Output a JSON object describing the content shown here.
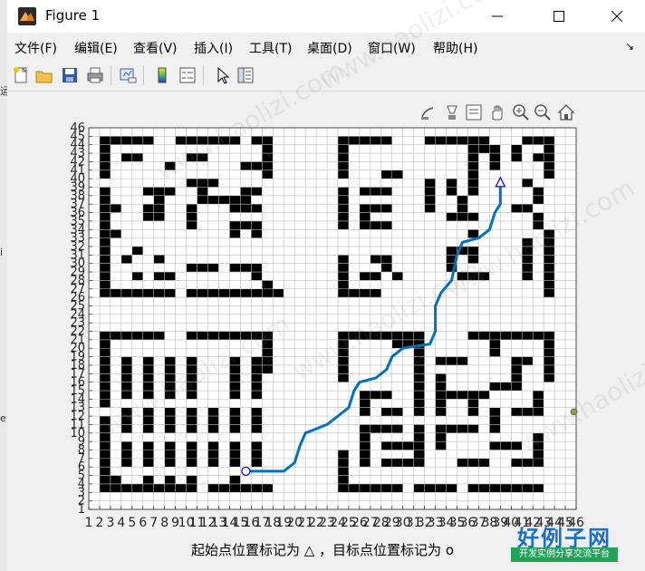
{
  "window": {
    "title": "Figure 1"
  },
  "menu": {
    "items": [
      "文件(F)",
      "编辑(E)",
      "查看(V)",
      "插入(I)",
      "工具(T)",
      "桌面(D)",
      "窗口(W)",
      "帮助(H)"
    ]
  },
  "toolbar": {
    "buttons": [
      "new-figure",
      "open",
      "save",
      "print",
      "link-plot",
      "insert-colorbar",
      "insert-legend",
      "edit-plot",
      "property-inspector"
    ]
  },
  "axes_toolbar": {
    "buttons": [
      "brush",
      "data-cursor",
      "data-tips",
      "pan",
      "zoom-in",
      "zoom-out",
      "home"
    ]
  },
  "caption": "起始点位置标记为 △ ，目标点位置标记为 o",
  "watermark": {
    "title": "好例子网",
    "subtitle": "开发实例分享交流平台",
    "diagonal_text": "www.haolizi.com"
  },
  "chart_data": {
    "type": "heatmap",
    "description_of_values": "occupancy grid 45x45: 1 = obstacle (black), 0 = free (white)",
    "x_ticks": [
      "1",
      "2",
      "3",
      "4",
      "5",
      "6",
      "7",
      "8",
      "9",
      "10",
      "11",
      "12",
      "13",
      "14",
      "15",
      "16",
      "17",
      "18",
      "19",
      "20",
      "21",
      "22",
      "23",
      "24",
      "25",
      "26",
      "27",
      "28",
      "29",
      "30",
      "31",
      "32",
      "33",
      "34",
      "35",
      "36",
      "37",
      "38",
      "39",
      "40",
      "41",
      "42",
      "43",
      "44",
      "45",
      "46"
    ],
    "y_ticks": [
      "1",
      "2",
      "3",
      "4",
      "5",
      "6",
      "7",
      "8",
      "9",
      "10",
      "11",
      "12",
      "13",
      "14",
      "15",
      "16",
      "17",
      "18",
      "19",
      "20",
      "21",
      "22",
      "23",
      "24",
      "25",
      "26",
      "27",
      "28",
      "29",
      "30",
      "31",
      "32",
      "33",
      "34",
      "35",
      "36",
      "37",
      "38",
      "39",
      "40",
      "41",
      "42",
      "43",
      "44",
      "45",
      "46"
    ],
    "xlim": [
      1,
      46
    ],
    "ylim": [
      1,
      46
    ],
    "grid": true,
    "start_marker": {
      "symbol": "triangle",
      "x": 39,
      "y": 39.5
    },
    "goal_marker": {
      "symbol": "circle",
      "x": 15.5,
      "y": 5.5
    },
    "path": [
      [
        15.5,
        5.5
      ],
      [
        19,
        5.5
      ],
      [
        20,
        6.5
      ],
      [
        20.5,
        8.5
      ],
      [
        21,
        10
      ],
      [
        22,
        10.5
      ],
      [
        23,
        11
      ],
      [
        24,
        12
      ],
      [
        25,
        13
      ],
      [
        25.5,
        15
      ],
      [
        26,
        16
      ],
      [
        27.5,
        16.5
      ],
      [
        28.5,
        17.5
      ],
      [
        29,
        19
      ],
      [
        30,
        20
      ],
      [
        32.5,
        20.5
      ],
      [
        33,
        22
      ],
      [
        33,
        25
      ],
      [
        33.5,
        26.5
      ],
      [
        34.5,
        28
      ],
      [
        35,
        31
      ],
      [
        35.5,
        32.5
      ],
      [
        37,
        33
      ],
      [
        38,
        34
      ],
      [
        38.5,
        36
      ],
      [
        39,
        37
      ],
      [
        39,
        39.5
      ]
    ],
    "obstacles": [
      [
        2,
        44,
        5,
        1
      ],
      [
        9,
        44,
        6,
        1
      ],
      [
        16,
        44,
        2,
        1
      ],
      [
        2,
        40,
        1,
        5
      ],
      [
        4,
        42,
        2,
        1
      ],
      [
        8,
        41,
        1,
        1
      ],
      [
        10,
        42,
        2,
        1
      ],
      [
        15,
        41,
        2,
        1
      ],
      [
        17,
        40,
        1,
        5
      ],
      [
        6,
        38,
        3,
        1
      ],
      [
        7,
        37,
        1,
        2
      ],
      [
        10,
        39,
        3,
        1
      ],
      [
        11,
        38,
        1,
        1
      ],
      [
        11,
        37,
        3,
        1
      ],
      [
        15,
        38,
        2,
        1
      ],
      [
        14,
        37,
        2,
        1
      ],
      [
        14,
        36,
        3,
        1
      ],
      [
        2,
        32,
        1,
        7
      ],
      [
        3,
        36,
        1,
        1
      ],
      [
        3,
        33,
        1,
        1
      ],
      [
        6,
        35,
        2,
        2
      ],
      [
        10,
        34,
        1,
        3
      ],
      [
        14,
        34,
        2,
        1
      ],
      [
        14,
        33,
        1,
        2
      ],
      [
        16,
        33,
        1,
        2
      ],
      [
        2,
        27,
        1,
        5
      ],
      [
        2,
        26,
        7,
        1
      ],
      [
        5,
        31,
        1,
        1
      ],
      [
        4,
        30,
        1,
        1
      ],
      [
        7,
        30,
        1,
        1
      ],
      [
        5,
        28,
        1,
        1
      ],
      [
        7,
        28,
        2,
        1
      ],
      [
        10,
        29,
        3,
        1
      ],
      [
        14,
        29,
        3,
        1
      ],
      [
        16,
        28,
        1,
        1
      ],
      [
        10,
        26,
        9,
        1
      ],
      [
        17,
        26,
        1,
        2
      ],
      [
        24,
        40,
        1,
        5
      ],
      [
        24,
        44,
        5,
        1
      ],
      [
        28,
        40,
        2,
        1
      ],
      [
        26,
        38,
        3,
        1
      ],
      [
        26,
        36,
        3,
        1
      ],
      [
        26,
        35,
        1,
        1
      ],
      [
        24,
        34,
        1,
        5
      ],
      [
        26,
        34,
        3,
        1
      ],
      [
        32,
        44,
        6,
        1
      ],
      [
        32,
        36,
        1,
        4
      ],
      [
        34,
        38,
        1,
        2
      ],
      [
        36,
        38,
        1,
        2
      ],
      [
        35,
        36,
        1,
        2
      ],
      [
        34,
        35,
        3,
        1
      ],
      [
        36,
        43,
        3,
        1
      ],
      [
        36,
        40,
        1,
        3
      ],
      [
        38,
        41,
        1,
        2
      ],
      [
        41,
        44,
        2,
        1
      ],
      [
        40,
        42,
        1,
        2
      ],
      [
        42,
        42,
        2,
        1
      ],
      [
        41,
        39,
        1,
        1
      ],
      [
        42,
        37,
        1,
        2
      ],
      [
        40,
        36,
        2,
        1
      ],
      [
        42,
        34,
        1,
        2
      ],
      [
        43,
        40,
        1,
        5
      ],
      [
        36,
        33,
        1,
        1
      ],
      [
        34,
        31,
        2,
        1
      ],
      [
        34,
        29,
        1,
        2
      ],
      [
        35,
        28,
        3,
        1
      ],
      [
        36,
        30,
        1,
        2
      ],
      [
        41,
        28,
        1,
        5
      ],
      [
        43,
        26,
        1,
        8
      ],
      [
        24,
        26,
        1,
        5
      ],
      [
        24,
        26,
        4,
        1
      ],
      [
        26,
        28,
        2,
        1
      ],
      [
        28,
        29,
        1,
        1
      ],
      [
        29,
        28,
        1,
        1
      ],
      [
        27,
        30,
        2,
        1
      ],
      [
        2,
        13,
        1,
        9
      ],
      [
        2,
        21,
        6,
        1
      ],
      [
        10,
        21,
        8,
        1
      ],
      [
        17,
        17,
        1,
        5
      ],
      [
        4,
        14,
        1,
        5
      ],
      [
        6,
        14,
        1,
        5
      ],
      [
        8,
        14,
        1,
        5
      ],
      [
        10,
        14,
        1,
        5
      ],
      [
        14,
        14,
        1,
        5
      ],
      [
        16,
        14,
        1,
        5
      ],
      [
        2,
        3,
        1,
        9
      ],
      [
        4,
        10,
        1,
        3
      ],
      [
        6,
        10,
        1,
        3
      ],
      [
        8,
        10,
        1,
        3
      ],
      [
        10,
        10,
        1,
        3
      ],
      [
        12,
        10,
        1,
        3
      ],
      [
        14,
        10,
        1,
        3
      ],
      [
        16,
        10,
        1,
        3
      ],
      [
        4,
        6,
        1,
        3
      ],
      [
        6,
        6,
        1,
        3
      ],
      [
        8,
        6,
        1,
        3
      ],
      [
        10,
        6,
        1,
        3
      ],
      [
        12,
        6,
        1,
        3
      ],
      [
        14,
        6,
        1,
        3
      ],
      [
        16,
        6,
        1,
        3
      ],
      [
        2,
        3,
        9,
        1
      ],
      [
        3,
        4,
        1,
        1
      ],
      [
        6,
        4,
        1,
        1
      ],
      [
        8,
        4,
        1,
        1
      ],
      [
        10,
        4,
        1,
        1
      ],
      [
        12,
        3,
        6,
        1
      ],
      [
        14,
        4,
        1,
        1
      ],
      [
        24,
        16,
        1,
        6
      ],
      [
        24,
        21,
        8,
        1
      ],
      [
        29,
        20,
        3,
        1
      ],
      [
        31,
        18,
        1,
        3
      ],
      [
        36,
        21,
        8,
        1
      ],
      [
        43,
        16,
        1,
        6
      ],
      [
        38,
        19,
        1,
        3
      ],
      [
        26,
        14,
        3,
        1
      ],
      [
        26,
        12,
        1,
        3
      ],
      [
        28,
        12,
        2,
        1
      ],
      [
        31,
        12,
        1,
        6
      ],
      [
        33,
        18,
        3,
        1
      ],
      [
        33,
        12,
        1,
        5
      ],
      [
        33,
        14,
        3,
        1
      ],
      [
        40,
        18,
        2,
        1
      ],
      [
        40,
        15,
        1,
        3
      ],
      [
        38,
        15,
        3,
        1
      ],
      [
        40,
        12,
        3,
        1
      ],
      [
        42,
        13,
        1,
        2
      ],
      [
        36,
        12,
        1,
        3
      ],
      [
        37,
        14,
        1,
        1
      ],
      [
        26,
        6,
        1,
        5
      ],
      [
        26,
        10,
        4,
        1
      ],
      [
        28,
        8,
        3,
        1
      ],
      [
        28,
        6,
        3,
        1
      ],
      [
        31,
        6,
        1,
        5
      ],
      [
        33,
        8,
        1,
        3
      ],
      [
        34,
        10,
        3,
        1
      ],
      [
        35,
        6,
        3,
        1
      ],
      [
        38,
        10,
        1,
        3
      ],
      [
        38,
        8,
        3,
        1
      ],
      [
        40,
        6,
        3,
        1
      ],
      [
        42,
        6,
        1,
        4
      ],
      [
        36,
        6,
        1,
        1
      ],
      [
        24,
        3,
        1,
        5
      ],
      [
        24,
        3,
        6,
        1
      ],
      [
        31,
        3,
        4,
        1
      ],
      [
        36,
        3,
        7,
        1
      ]
    ]
  }
}
